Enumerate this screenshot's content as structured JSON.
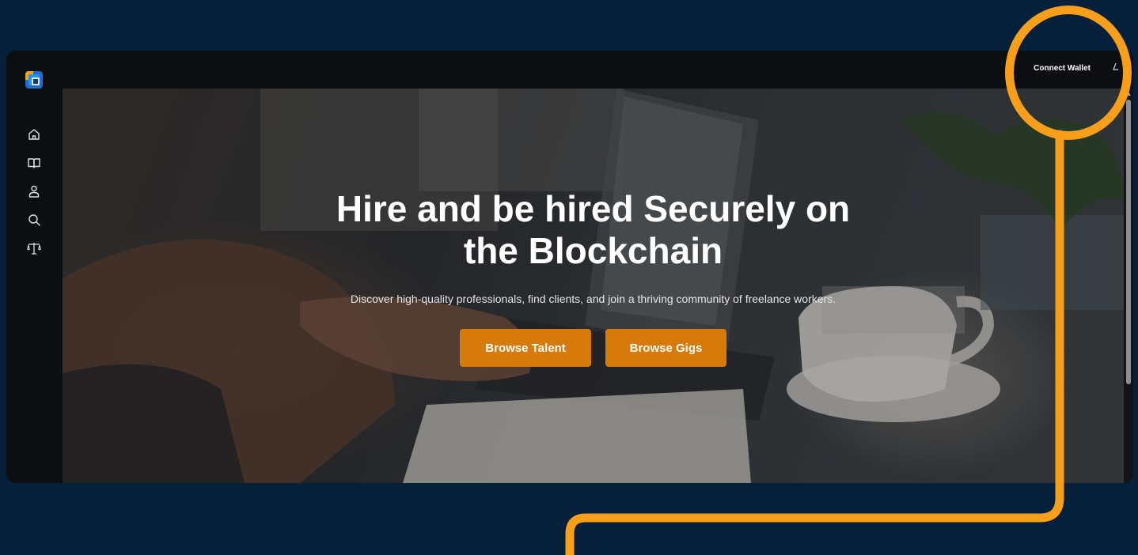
{
  "header": {
    "connect_wallet_label": "Connect Wallet"
  },
  "sidebar": {
    "items": [
      {
        "name": "home",
        "icon": "home-icon"
      },
      {
        "name": "book",
        "icon": "book-open-icon"
      },
      {
        "name": "profile",
        "icon": "user-icon"
      },
      {
        "name": "search",
        "icon": "search-icon"
      },
      {
        "name": "disputes",
        "icon": "scale-icon"
      }
    ]
  },
  "hero": {
    "title": "Hire and be hired Securely on the Blockchain",
    "subtitle": "Discover high-quality professionals, find clients, and join a thriving community of freelance workers.",
    "browse_talent_label": "Browse Talent",
    "browse_gigs_label": "Browse Gigs"
  },
  "colors": {
    "page_background": "#061f3b",
    "accent_button": "#d67a09",
    "callout": "#f79f1a",
    "app_background": "#0c0e12"
  }
}
